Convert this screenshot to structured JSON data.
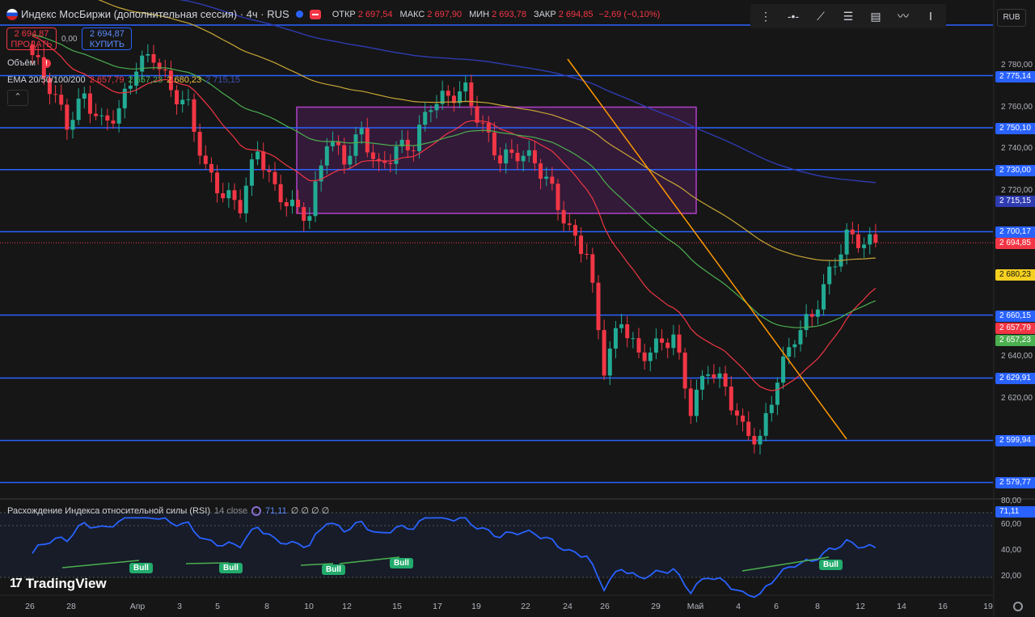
{
  "header": {
    "title": "Индекс МосБиржи (дополнительная сессия) · 4ч · RUS",
    "ohlc": [
      {
        "k": "ОТКР",
        "v": "2 697,54"
      },
      {
        "k": "МАКС",
        "v": "2 697,90"
      },
      {
        "k": "МИН",
        "v": "2 693,78"
      },
      {
        "k": "ЗАКР",
        "v": "2 694,85"
      },
      {
        "k": "",
        "v": "−2,69 (−0,10%)"
      }
    ]
  },
  "trade": {
    "sell_price": "2 694,87",
    "sell_label": "ПРОДАТЬ",
    "spread": "0,00",
    "buy_price": "2 694,87",
    "buy_label": "КУПИТЬ"
  },
  "volume_label": "Объём",
  "ema": {
    "label": "EMA 20/50/100/200",
    "v20": "2 657,79",
    "v50": "2 657,23",
    "v100": "2 680,23",
    "v200": "2 715,15"
  },
  "currency": "RUB",
  "colors": {
    "bg": "#161616",
    "up": "#22ab94",
    "down": "#f23645",
    "level": "#2962ff",
    "range_box": "#9c27b0",
    "ema20": "#f23645",
    "ema50": "#4caf50",
    "ema100": "#c7a535",
    "ema200": "#2f3bb0",
    "trendline": "#ff9800",
    "rsi": "#2962ff",
    "divergence": "#4caf50"
  },
  "price_axis": {
    "ticks": [
      "2 780,00",
      "2 760,00",
      "2 740,00",
      "2 720,00",
      "2 620,00",
      "2 640,00"
    ],
    "levels": [
      "2 775,14",
      "2 750,10",
      "2 730,00",
      "2 700,17",
      "2 660,15",
      "2 629,91",
      "2 599,94",
      "2 579,77"
    ],
    "current": "2 694,85",
    "ema100_label": "2 680,23",
    "ema200_label": "2 715,15",
    "ema20_label": "2 657,79",
    "ema50_label": "2 657,23"
  },
  "chart_data": {
    "type": "candlestick",
    "levels": [
      2775.14,
      2750.1,
      2730.0,
      2700.17,
      2660.15,
      2629.91,
      2599.94,
      2579.77
    ],
    "range_box": {
      "from": "10 Апр",
      "to": "30 Апр",
      "high": 2760,
      "low": 2709
    },
    "candles_close_approx": [
      2785,
      2770,
      2752,
      2765,
      2752,
      2758,
      2780,
      2785,
      2768,
      2760,
      2730,
      2718,
      2713,
      2740,
      2720,
      2712,
      2708,
      2745,
      2735,
      2748,
      2730,
      2740,
      2742,
      2762,
      2765,
      2768,
      2750,
      2735,
      2738,
      2734,
      2720,
      2700,
      2690,
      2635,
      2658,
      2640,
      2645,
      2650,
      2615,
      2635,
      2625,
      2605,
      2600,
      2630,
      2650,
      2660,
      2680,
      2698,
      2695
    ],
    "rsi": {
      "label": "Расхождение Индекса относительной силы (RSI)",
      "period": "14 close",
      "value": "71,11",
      "extras": "∅ ∅ ∅ ∅",
      "ticks": [
        "80,00",
        "60,00",
        "40,00",
        "20,00"
      ],
      "current": "71,11"
    },
    "bull_labels": [
      "Bull",
      "Bull",
      "Bull",
      "Bull",
      "Bull"
    ],
    "x_labels": [
      "26",
      "28",
      "Апр",
      "3",
      "5",
      "8",
      "10",
      "12",
      "15",
      "17",
      "19",
      "22",
      "24",
      "26",
      "29",
      "Май",
      "4",
      "6",
      "8",
      "12",
      "14",
      "16",
      "19"
    ]
  },
  "branding": "TradingView"
}
